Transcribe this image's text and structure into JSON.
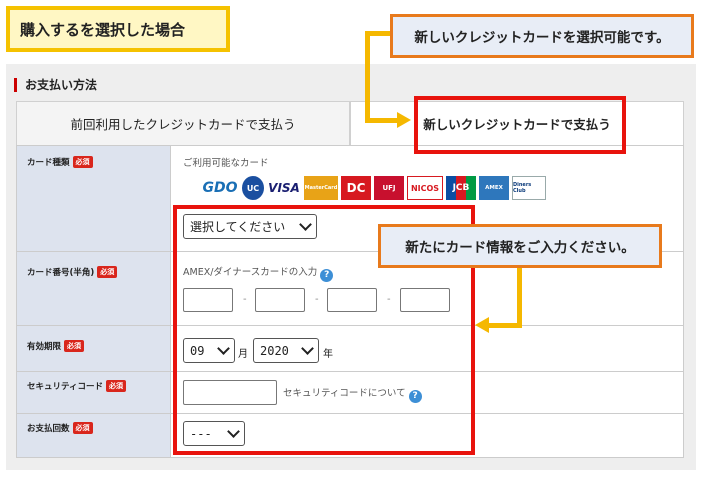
{
  "callouts": {
    "main_title": "購入するを選択した場合",
    "new_card_note": "新しいクレジットカードを選択可能です。",
    "input_note": "新たにカード情報をご入力ください。"
  },
  "payment": {
    "section_title": "お支払い方法",
    "tabs": [
      {
        "label": "前回利用したクレジットカードで支払う"
      },
      {
        "label": "新しいクレジットカードで支払う"
      }
    ]
  },
  "required_badge": "必須",
  "form": {
    "card_type": {
      "label": "カード種類",
      "available_text": "ご利用可能なカード",
      "brands": [
        "GDO",
        "UC",
        "VISA",
        "MasterCard",
        "DC",
        "UFJ",
        "NICOS",
        "JCB",
        "AMEX",
        "Diners Club"
      ],
      "select_value": "選択してください"
    },
    "card_number": {
      "label": "カード番号(半角)",
      "amex_hint": "AMEX/ダイナースカードの入力",
      "separator": "-"
    },
    "expiry": {
      "label": "有効期限",
      "month_value": "09",
      "month_unit": "月",
      "year_value": "2020",
      "year_unit": "年"
    },
    "security_code": {
      "label": "セキュリティコード",
      "help_text": "セキュリティコードについて"
    },
    "installments": {
      "label": "お支払回数",
      "select_value": "---"
    }
  },
  "colors": {
    "highlight_red": "#e8130d",
    "annotation_orange": "#e87a1c",
    "annotation_yellow": "#f5c200",
    "required_red": "#d9261c",
    "label_bg": "#dde3ee"
  }
}
